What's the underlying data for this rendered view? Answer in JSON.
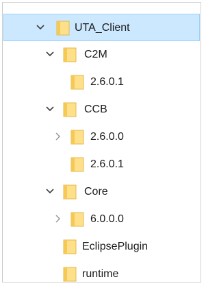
{
  "tree": {
    "items": [
      {
        "label": "UTA_Client",
        "expanded": true,
        "selected": true
      },
      {
        "label": "C2M",
        "expanded": true
      },
      {
        "label": "2.6.0.1"
      },
      {
        "label": "CCB",
        "expanded": true
      },
      {
        "label": "2.6.0.0",
        "expanded": false
      },
      {
        "label": "2.6.0.1"
      },
      {
        "label": "Core",
        "expanded": true
      },
      {
        "label": "6.0.0.0",
        "expanded": false
      },
      {
        "label": "EclipsePlugin"
      },
      {
        "label": "runtime"
      }
    ]
  },
  "colors": {
    "selection_bg": "#cce8ff",
    "selection_border": "#99d1ff",
    "folder_body": "#ffe08a",
    "folder_edge": "#e0b84a",
    "text": "#1b1b1b"
  },
  "icons": {
    "expanded": "chevron-down-icon",
    "collapsed": "chevron-right-icon",
    "folder": "folder-icon"
  }
}
